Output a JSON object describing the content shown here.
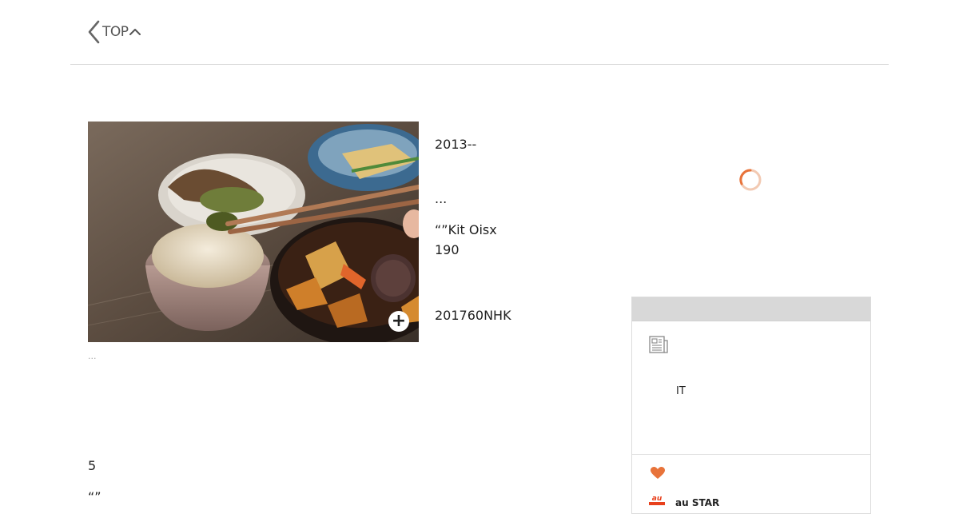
{
  "header": {
    "back_label": "TOP"
  },
  "article": {
    "photo_alt": "Japanese home-style meal with rice, simmered vegetables and chopsticks",
    "caption": "...",
    "lines": {
      "date": "2013--",
      "ellipsis": "...",
      "kit_line1": "“”Kit Oisx",
      "kit_line2": "190",
      "nhk": "201760NHK"
    },
    "body": {
      "number": "5",
      "quote": "“”"
    }
  },
  "side_panel": {
    "item_label": "IT",
    "au_label": "au STAR"
  },
  "icons": {
    "back": "chevron-left-icon",
    "top": "chevron-up-icon",
    "zoom": "plus-icon",
    "news": "newspaper-icon",
    "heart": "heart-icon",
    "logo": "au-logo",
    "loading": "loading-spinner"
  },
  "colors": {
    "accent_orange": "#e8733a",
    "panel_header": "#d8d8d8",
    "rule": "#d6d6d6"
  }
}
